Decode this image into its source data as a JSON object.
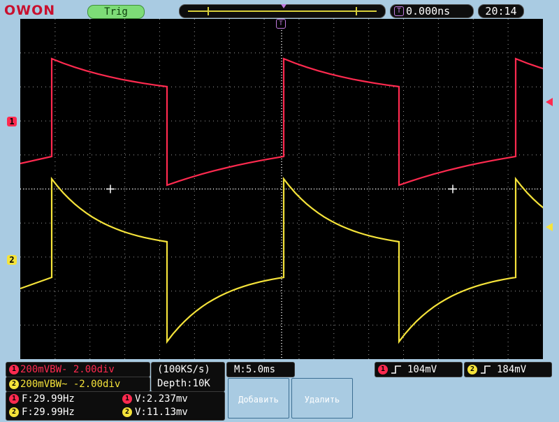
{
  "brand": "OWON",
  "status": {
    "trigger_state": "Trig",
    "trigger_position": "0.000ns",
    "clock": "20:14"
  },
  "channels": {
    "ch1": {
      "label": "1",
      "scale": "200mVBW- 2.00div",
      "trigger": "104mV",
      "frequency": "F:29.99Hz",
      "voltage": "V:2.237mv",
      "color": "#ff2a4f"
    },
    "ch2": {
      "label": "2",
      "scale": "200mVBW~ -2.00div",
      "trigger": "184mV",
      "frequency": "F:29.99Hz",
      "voltage": "V:11.13mv",
      "color": "#f5e33a"
    }
  },
  "acquisition": {
    "sample_rate": "(100KS/s)",
    "depth": "Depth:10K",
    "timebase": "M:5.0ms"
  },
  "softkeys": {
    "add": "Добавить",
    "delete": "Удалить"
  },
  "icons": {
    "trigger_marker": "T",
    "ch1_edge": "rising-edge-icon",
    "ch2_edge": "rising-edge-icon"
  },
  "colors": {
    "screen": "#000000",
    "frame": "#a9cbe2",
    "grid": "#cfcfcf"
  }
}
